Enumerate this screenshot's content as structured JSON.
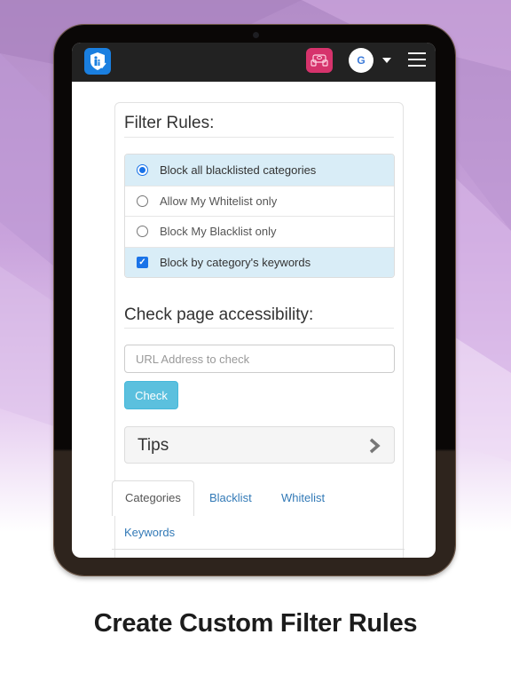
{
  "navbar": {
    "logo_icon": "shield-family-icon",
    "car_icon": "car-icon",
    "avatar_initial": "G",
    "dropdown_icon": "caret-down-icon",
    "menu_icon": "hamburger-icon"
  },
  "filter_rules": {
    "title": "Filter Rules:",
    "options": [
      {
        "label": "Block all blacklisted categories",
        "type": "radio",
        "checked": true
      },
      {
        "label": "Allow My Whitelist only",
        "type": "radio",
        "checked": false
      },
      {
        "label": "Block My Blacklist only",
        "type": "radio",
        "checked": false
      },
      {
        "label": "Block by category's keywords",
        "type": "checkbox",
        "checked": true
      }
    ]
  },
  "accessibility": {
    "title": "Check page accessibility:",
    "url_placeholder": "URL Address to check",
    "url_value": "",
    "check_label": "Check"
  },
  "tips": {
    "label": "Tips",
    "chevron_icon": "chevron-right-icon"
  },
  "tabs": [
    {
      "label": "Categories",
      "active": true
    },
    {
      "label": "Blacklist",
      "active": false
    },
    {
      "label": "Whitelist",
      "active": false
    },
    {
      "label": "Keywords",
      "active": false
    }
  ],
  "caption": "Create Custom Filter Rules",
  "colors": {
    "accent": "#1a73e8",
    "active_row": "#d9edf7",
    "check_button": "#5bc0de",
    "car_button": "#d6336c",
    "logo": "#1a7fe0",
    "navbar": "#222222",
    "tab_link": "#337ab7"
  }
}
